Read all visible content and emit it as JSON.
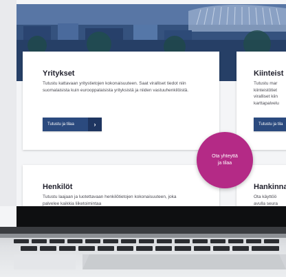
{
  "cards": {
    "yritykset": {
      "title": "Yritykset",
      "text": "Tutustu kattavaan yritystietojen kokonaisuuteen. Saat viralliset tiedot niin suomalaisista kuin eurooppalaisista yrityksistä ja niiden vastuuhenkilöistä.",
      "button": "Tutustu ja tilaa"
    },
    "kiinteistot": {
      "title": "Kiinteist",
      "text": "Tutustu mar kiinteistötiet viralliset kiin karttapalvelu",
      "button": "Tutustu ja tila"
    },
    "henkilot": {
      "title": "Henkilöt",
      "text": "Tutustu laajaan ja luotettavaan henkilötietojen kokonaisuuteen, joka palvelee kaikkia liiketoimintaa"
    },
    "hankinnat": {
      "title": "Hankinna",
      "text": "Ota käyttöö avulla seura"
    }
  },
  "contact": {
    "line1": "Ota yhteyttä",
    "line2": "ja tilaa"
  },
  "icons": {
    "button_arrow": "chevron-right-icon"
  },
  "colors": {
    "button": "#2b4a7e",
    "button_arrow_bg": "#1e3560",
    "contact_circle": "#b42a86",
    "hero": "#33527f"
  }
}
